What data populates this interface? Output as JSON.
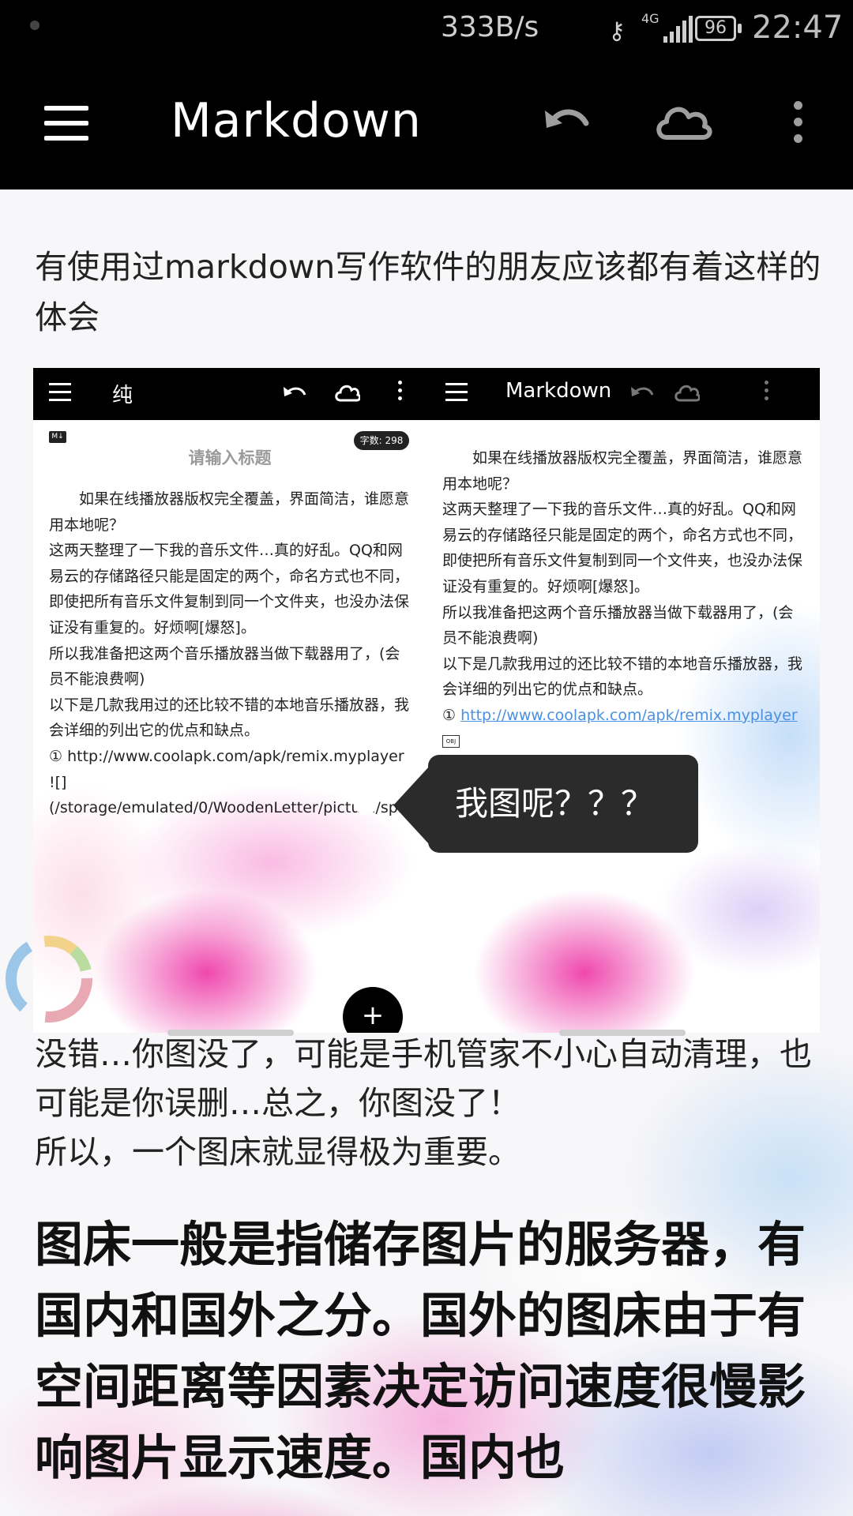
{
  "status_bar": {
    "net_speed": "333B/s",
    "network": "4G",
    "battery": "96",
    "time": "22:47",
    "icons": [
      "key-icon",
      "signal-icon",
      "battery-icon"
    ]
  },
  "app_bar": {
    "title": "Markdown",
    "icons": [
      "menu-icon",
      "undo-icon",
      "cloud-icon",
      "more-icon"
    ]
  },
  "content": {
    "intro": "有使用过markdown写作软件的朋友应该都有着这样的体会",
    "embedded_screenshot": {
      "left": {
        "title": "纯",
        "badge": "M↓",
        "word_count": "字数: 298",
        "placeholder": "请输入标题",
        "body": "　　如果在线播放器版权完全覆盖，界面简洁，谁愿意用本地呢？\n这两天整理了一下我的音乐文件…真的好乱。QQ和网易云的存储路径只能是固定的两个，命名方式也不同，即使把所有音乐文件复制到同一个文件夹，也没办法保证没有重复的。好烦啊[爆怒]。\n所以我准备把这两个音乐播放器当做下载器用了，(会员不能浪费啊)\n以下是几款我用过的还比较不错的本地音乐播放器，我会详细的列出它的优点和缺点。\n① http://www.coolapk.com/apk/remix.myplayer\n![](/storage/emulated/0/WoodenLetter/picture/splice/splice_212121310.png)",
        "fab": "+"
      },
      "right": {
        "title": "Markdown",
        "body": "　　如果在线播放器版权完全覆盖，界面简洁，谁愿意用本地呢？\n这两天整理了一下我的音乐文件…真的好乱。QQ和网易云的存储路径只能是固定的两个，命名方式也不同，即使把所有音乐文件复制到同一个文件夹，也没办法保证没有重复的。好烦啊[爆怒]。\n所以我准备把这两个音乐播放器当做下载器用了，(会员不能浪费啊)\n以下是几款我用过的还比较不错的本地音乐播放器，我会详细的列出它的优点和缺点。",
        "link_prefix": "① ",
        "link": "http://www.coolapk.com/apk/remix.myplayer",
        "obj": "OBJ"
      },
      "tooltip": "我图呢？？？"
    },
    "after": "没错…你图没了，可能是手机管家不小心自动清理，也可能是你误删…总之，你图没了！\n所以，一个图床就显得极为重要。",
    "heading": "图床一般是指储存图片的服务器，有国内和国外之分。国外的图床由于有空间距离等因素决定访问速度很慢影响图片显示速度。国内也"
  },
  "colors": {
    "app_bar_bg": "#000000",
    "link": "#4a90e2",
    "tooltip_bg": "#2b2b2b",
    "accent_pink": "#ec28a0"
  }
}
